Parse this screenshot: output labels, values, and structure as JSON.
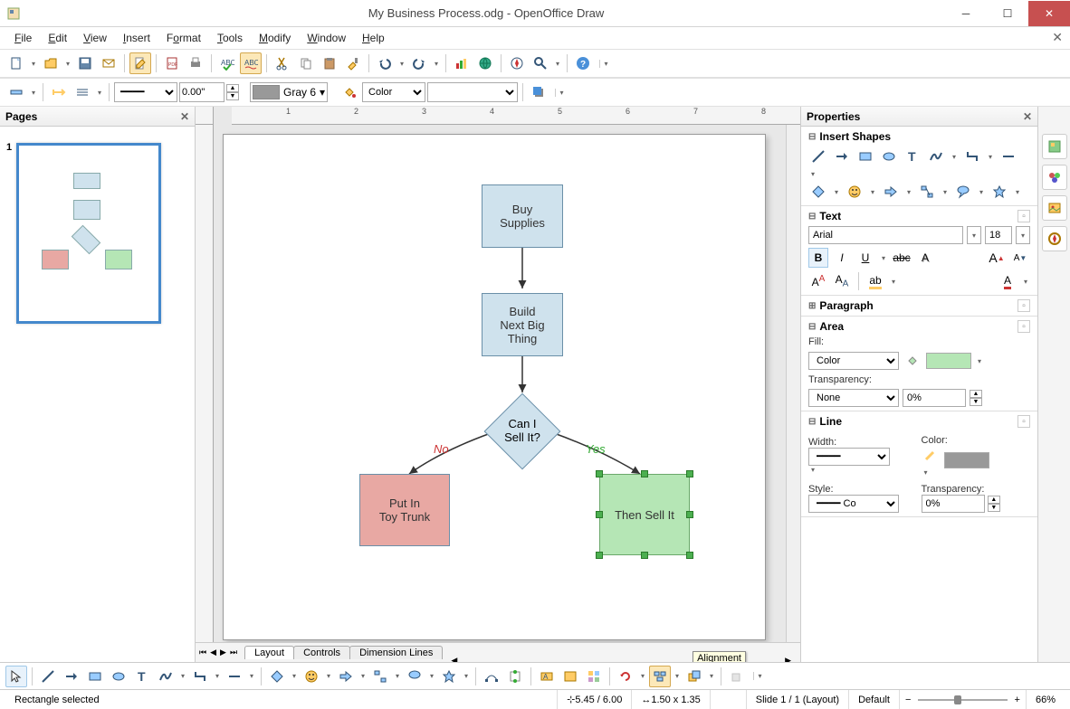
{
  "window": {
    "title": "My Business Process.odg - OpenOffice Draw"
  },
  "menu": [
    "File",
    "Edit",
    "View",
    "Insert",
    "Format",
    "Tools",
    "Modify",
    "Window",
    "Help"
  ],
  "toolbar2": {
    "width": "0.00\"",
    "color_label": "Gray 6",
    "fill_mode": "Color"
  },
  "pages": {
    "title": "Pages",
    "page_num": "1"
  },
  "canvas": {
    "nodes": {
      "buy": "Buy\nSupplies",
      "build": "Build\nNext Big\nThing",
      "decide": "Can I\nSell It?",
      "no_label": "No",
      "yes_label": "Yes",
      "putin": "Put In\nToy Trunk",
      "sell": "Then Sell It"
    },
    "tabs": [
      "Layout",
      "Controls",
      "Dimension Lines"
    ],
    "tooltip": "Alignment"
  },
  "properties": {
    "title": "Properties",
    "sections": {
      "shapes": "Insert Shapes",
      "text": "Text",
      "paragraph": "Paragraph",
      "area": "Area",
      "line": "Line"
    },
    "text": {
      "font": "Arial",
      "size": "18"
    },
    "area": {
      "fill_label": "Fill:",
      "fill_mode": "Color",
      "fill_color": "#b5e6b5",
      "transp_label": "Transparency:",
      "transp_mode": "None",
      "transp_val": "0%"
    },
    "line": {
      "width_label": "Width:",
      "color_label": "Color:",
      "style_label": "Style:",
      "style_val": "Co",
      "transp_label": "Transparency:",
      "transp_val": "0%"
    }
  },
  "status": {
    "selection": "Rectangle selected",
    "pos": "5.45 / 6.00",
    "size": "1.50 x 1.35",
    "slide": "Slide 1 / 1 (Layout)",
    "template": "Default",
    "zoom": "66%"
  }
}
